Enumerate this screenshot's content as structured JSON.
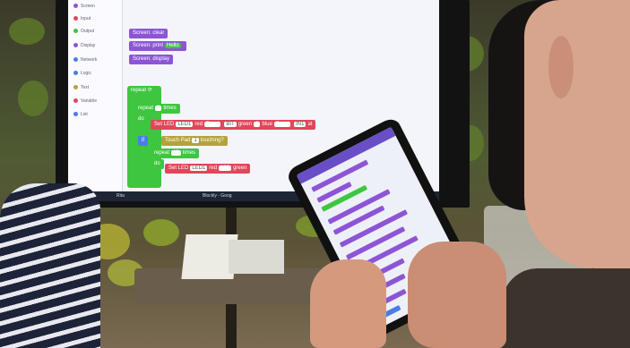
{
  "scene": {
    "sidebar": [
      {
        "label": "Screen",
        "color": "#8d55d6"
      },
      {
        "label": "Input",
        "color": "#e0475a"
      },
      {
        "label": "Output",
        "color": "#3ec640"
      },
      {
        "label": "Display",
        "color": "#8d55d6"
      },
      {
        "label": "Network",
        "color": "#4a7ce8"
      },
      {
        "label": "Logic",
        "color": "#4a7ce8"
      },
      {
        "label": "Text",
        "color": "#b5a23a"
      },
      {
        "label": "Variable",
        "color": "#e0475a"
      },
      {
        "label": "List",
        "color": "#4a7ce8"
      }
    ],
    "blocks": {
      "clear": "Screen: clear",
      "print": "Screen: print",
      "print_text": "Hello",
      "display": "Screen: display",
      "repeat_top": "repeat",
      "repeat": "repeat",
      "repeat_n": "8",
      "times": "times",
      "do": "do",
      "set_led": "Set LED",
      "led_var": "LED1",
      "red": "red",
      "read": "Read",
      "read_var": "BIT",
      "green": "green",
      "blue": "blue",
      "read2": "Read",
      "read_var2": "IN1",
      "at": "at",
      "if": "if",
      "touch": "Touch Pad",
      "touch_n": "1",
      "touching": "touching?",
      "repeat2": "repeat",
      "repeat2_n": "10",
      "times2": "times",
      "do2": "do",
      "set_led2": "Set LED",
      "led_var2": "LED1",
      "red2": "red",
      "red2_v": "100",
      "green2": "green"
    },
    "taskbar": {
      "start": "⊞",
      "search": "Rita",
      "app": "Blockly - Goog"
    },
    "colors": {
      "purple": "#8d55d6",
      "green": "#3ec640",
      "blue": "#4a7ce8"
    }
  }
}
